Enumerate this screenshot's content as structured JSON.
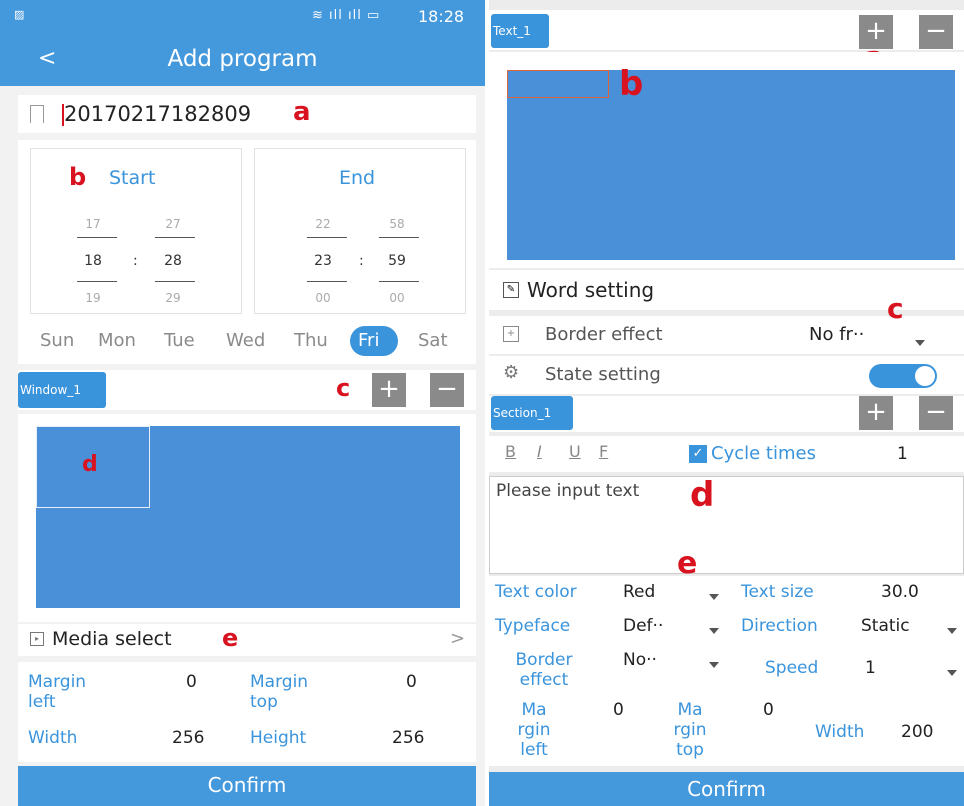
{
  "left": {
    "status": {
      "time": "18:28"
    },
    "header": {
      "back": "<",
      "title": "Add program"
    },
    "program_name": {
      "value": "20170217182809",
      "marker": "a"
    },
    "schedule": {
      "marker": "b",
      "start": {
        "label": "Start",
        "hour_prev": "17",
        "hour": "18",
        "hour_next": "19",
        "min_prev": "27",
        "min": "28",
        "min_next": "29",
        "sep": ":"
      },
      "end": {
        "label": "End",
        "hour_prev": "22",
        "hour": "23",
        "hour_next": "00",
        "min_prev": "58",
        "min": "59",
        "min_next": "00",
        "sep": ":"
      }
    },
    "days": [
      "Sun",
      "Mon",
      "Tue",
      "Wed",
      "Thu",
      "Fri",
      "Sat"
    ],
    "window_tab": {
      "label": "Window_1",
      "marker": "c"
    },
    "canvas_marker": "d",
    "media": {
      "label": "Media select",
      "marker": "e",
      "chevron": ">"
    },
    "fields": {
      "margin_left_label": "Margin left",
      "margin_left": "0",
      "margin_top_label": "Margin top",
      "margin_top": "0",
      "width_label": "Width",
      "width": "256",
      "height_label": "Height",
      "height": "256"
    },
    "confirm": "Confirm"
  },
  "right": {
    "text_tab": {
      "label": "Text_1",
      "marker": "a"
    },
    "canvas_marker": "b",
    "word_setting": "Word setting",
    "border_effect": {
      "label": "Border effect",
      "value": "No fr··",
      "marker": "c"
    },
    "state_setting": {
      "label": "State setting"
    },
    "section_tab": {
      "label": "Section_1"
    },
    "format": {
      "bold": "B",
      "italic": "I",
      "underline": "U",
      "f": "F",
      "cycle_label": "Cycle times",
      "cycle_value": "1"
    },
    "text_input": {
      "placeholder": "Please input text",
      "marker": "d"
    },
    "marker_e": "e",
    "props": {
      "text_color_label": "Text color",
      "text_color": "Red",
      "text_size_label": "Text size",
      "text_size": "30.0",
      "typeface_label": "Typeface",
      "typeface": "Def··",
      "direction_label": "Direction",
      "direction": "Static",
      "border_effect_label": "Border effect",
      "border_effect": "No··",
      "speed_label": "Speed",
      "speed": "1",
      "margin_left_label": "Ma rgin left",
      "margin_left": "0",
      "margin_top_label": "Ma rgin top",
      "margin_top": "0",
      "width_label": "Width",
      "width": "200"
    },
    "confirm": "Confirm"
  },
  "colors": {
    "accent": "#4498dc",
    "canvas": "#4a90d9",
    "marker": "#d8121e",
    "button_gray": "#8a8a8a"
  }
}
